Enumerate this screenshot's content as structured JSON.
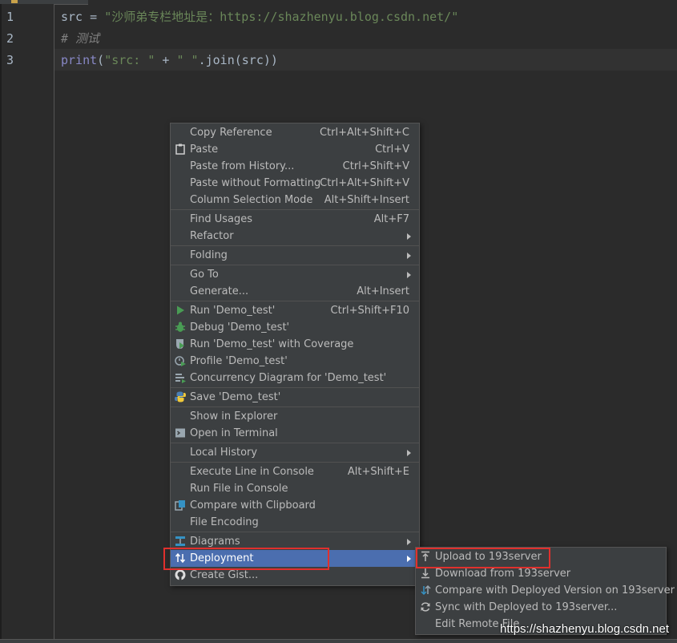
{
  "editor": {
    "line_numbers": [
      "1",
      "2",
      "3"
    ],
    "line1": {
      "var": "src = ",
      "str": "\"沙师弟专栏地址是：https://shazhenyu.blog.csdn.net/\""
    },
    "line2": {
      "comment": "# 测试"
    },
    "line3": {
      "print": "print",
      "open": "(",
      "str1": "\"src: \"",
      "plus": " + ",
      "str2": "\" \"",
      "rest": ".join(src))"
    }
  },
  "context_menu": {
    "items": [
      {
        "label": "Copy Reference",
        "shortcut": "Ctrl+Alt+Shift+C"
      },
      {
        "label": "Paste",
        "shortcut": "Ctrl+V",
        "icon": "clipboard-icon"
      },
      {
        "label": "Paste from History...",
        "shortcut": "Ctrl+Shift+V"
      },
      {
        "label": "Paste without Formatting",
        "shortcut": "Ctrl+Alt+Shift+V"
      },
      {
        "label": "Column Selection Mode",
        "shortcut": "Alt+Shift+Insert"
      },
      {
        "label": "Find Usages",
        "shortcut": "Alt+F7"
      },
      {
        "label": "Refactor",
        "submenu": true
      },
      {
        "label": "Folding",
        "submenu": true
      },
      {
        "label": "Go To",
        "submenu": true
      },
      {
        "label": "Generate...",
        "shortcut": "Alt+Insert"
      },
      {
        "label": "Run 'Demo_test'",
        "shortcut": "Ctrl+Shift+F10",
        "icon": "run-icon"
      },
      {
        "label": "Debug 'Demo_test'",
        "icon": "debug-icon"
      },
      {
        "label": "Run 'Demo_test' with Coverage",
        "icon": "coverage-icon"
      },
      {
        "label": "Profile 'Demo_test'",
        "icon": "profile-icon"
      },
      {
        "label": "Concurrency Diagram for 'Demo_test'",
        "icon": "concurrency-icon"
      },
      {
        "label": "Save 'Demo_test'",
        "icon": "python-icon"
      },
      {
        "label": "Show in Explorer"
      },
      {
        "label": "Open in Terminal",
        "icon": "terminal-icon"
      },
      {
        "label": "Local History",
        "submenu": true
      },
      {
        "label": "Execute Line in Console",
        "shortcut": "Alt+Shift+E"
      },
      {
        "label": "Run File in Console"
      },
      {
        "label": "Compare with Clipboard",
        "icon": "compare-icon"
      },
      {
        "label": "File Encoding"
      },
      {
        "label": "Diagrams",
        "submenu": true,
        "icon": "diagram-icon"
      },
      {
        "label": "Deployment",
        "submenu": true,
        "icon": "deployment-icon",
        "selected": true
      },
      {
        "label": "Create Gist...",
        "icon": "github-icon"
      }
    ]
  },
  "deployment_submenu": {
    "items": [
      {
        "label": "Upload to 193server",
        "icon": "upload-icon"
      },
      {
        "label": "Download from 193server",
        "icon": "download-icon"
      },
      {
        "label": "Compare with Deployed Version on 193server",
        "icon": "compare-deployed-icon"
      },
      {
        "label": "Sync with Deployed to 193server...",
        "icon": "sync-icon"
      },
      {
        "label": "Edit Remote File"
      }
    ]
  },
  "watermark": "https://shazhenyu.blog.csdn.net",
  "colors": {
    "menu_bg": "#3c3f41",
    "selected_bg": "#4b6eaf",
    "highlight_box": "#e0302d",
    "string": "#6a8759",
    "comment": "#808080"
  }
}
